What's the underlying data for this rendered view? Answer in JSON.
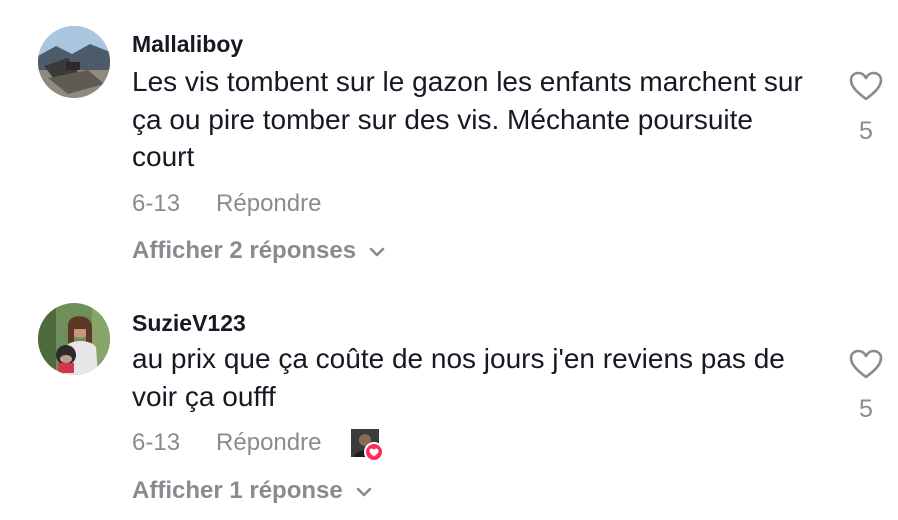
{
  "comments": [
    {
      "username": "Mallaliboy",
      "text": "Les vis tombent sur le gazon les enfants marchent sur ça ou pire tomber sur des vis. Méchante poursuite court",
      "date": "6-13",
      "reply_label": "Répondre",
      "view_replies": "Afficher 2 réponses",
      "like_count": "5",
      "liked_by_creator": false
    },
    {
      "username": "SuzieV123",
      "text": "au prix que ça coûte de nos jours j'en reviens pas de voir ça oufff",
      "date": "6-13",
      "reply_label": "Répondre",
      "view_replies": "Afficher 1 réponse",
      "like_count": "5",
      "liked_by_creator": true
    }
  ],
  "icons": {
    "like": "heart-outline-icon",
    "expand": "chevron-down-icon",
    "creator_heart": "heart-filled-icon"
  },
  "colors": {
    "text_primary": "#161823",
    "text_secondary": "#8a8b91",
    "accent": "#fe2c55"
  }
}
